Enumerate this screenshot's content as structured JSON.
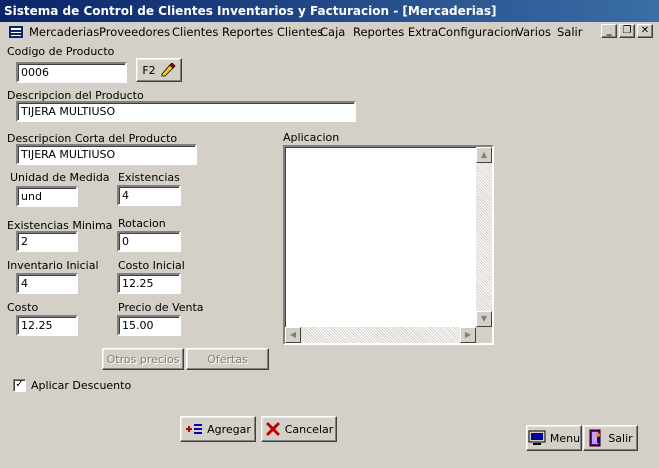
{
  "window": {
    "title": "Sistema de Control de Clientes Inventarios y Facturacion - [Mercaderias]"
  },
  "menu": [
    "Mercaderias",
    "Proveedores",
    "Clientes",
    "Reportes Clientes",
    "Caja",
    "Reportes Extra",
    "Configuracion",
    "Varios",
    "Salir"
  ],
  "form": {
    "codigo": {
      "label": "Codigo de Producto",
      "value": "0006",
      "lookup_label": "F2"
    },
    "descripcion": {
      "label": "Descripcion del Producto",
      "value": "TIJERA MULTIUSO"
    },
    "descripcion_corta": {
      "label": "Descripcion Corta del Producto",
      "value": "TIJERA MULTIUSO"
    },
    "unidad": {
      "label": "Unidad de Medida",
      "value": "und"
    },
    "existencias": {
      "label": "Existencias",
      "value": "4"
    },
    "existencias_minima": {
      "label": "Existencias Minima",
      "value": "2"
    },
    "rotacion": {
      "label": "Rotacion",
      "value": "0"
    },
    "inventario_inicial": {
      "label": "Inventario Inicial",
      "value": "4"
    },
    "costo_inicial": {
      "label": "Costo Inicial",
      "value": "12.25"
    },
    "costo": {
      "label": "Costo",
      "value": "12.25"
    },
    "precio_venta": {
      "label": "Precio de Venta",
      "value": "15.00"
    },
    "aplicacion": {
      "label": "Aplicacion",
      "value": ""
    },
    "aplicar_descuento": {
      "label": "Aplicar Descuento",
      "checked": true
    }
  },
  "buttons": {
    "otros_precios": "Otros precios",
    "ofertas": "Ofertas",
    "agregar": "Agregar",
    "cancelar": "Cancelar",
    "menu": "Menu",
    "salir": "Salir"
  }
}
